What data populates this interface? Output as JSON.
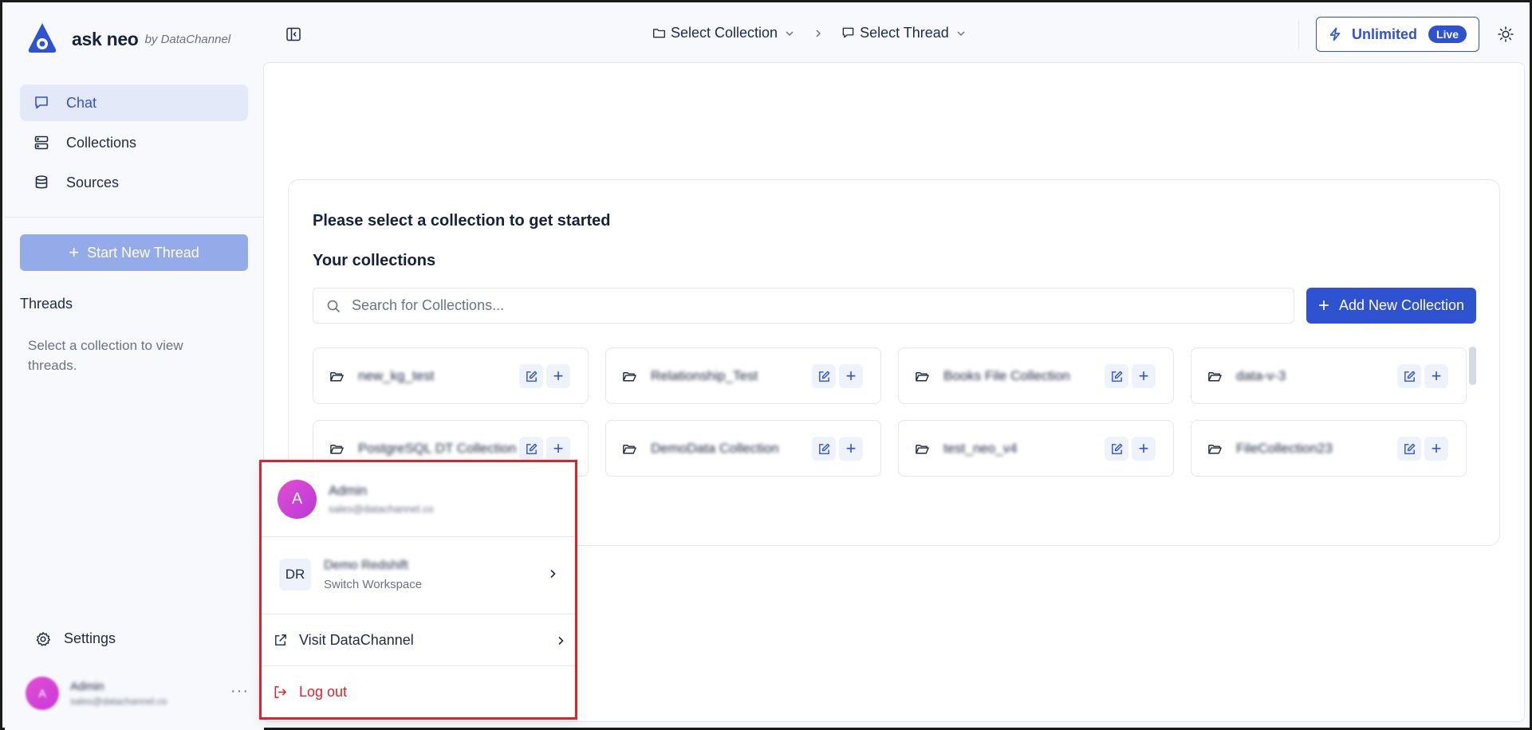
{
  "brand": {
    "name": "ask neo",
    "by": "by DataChannel"
  },
  "nav": [
    {
      "label": "Chat",
      "icon": "chat-icon",
      "active": true
    },
    {
      "label": "Collections",
      "icon": "collections-icon",
      "active": false
    },
    {
      "label": "Sources",
      "icon": "database-icon",
      "active": false
    }
  ],
  "sidebar": {
    "start_thread": "Start New Thread",
    "threads_title": "Threads",
    "threads_empty": "Select a collection to view threads.",
    "settings": "Settings",
    "user": {
      "initial": "A",
      "name": "Admin",
      "email": "sales@datachannel.co"
    },
    "more": "···"
  },
  "topbar": {
    "collection": "Select Collection",
    "thread": "Select Thread",
    "plan": "Unlimited",
    "plan_badge": "Live"
  },
  "main": {
    "title": "Please select a collection to get started",
    "subtitle": "Your collections",
    "search_placeholder": "Search for Collections...",
    "add_button": "Add New Collection",
    "collections": [
      "new_kg_test",
      "Relationship_Test",
      "Books File Collection",
      "data-v-3",
      "PostgreSQL DT Collection",
      "DemoData Collection",
      "test_neo_v4",
      "FileCollection23"
    ]
  },
  "popup": {
    "user_initial": "A",
    "user_name": "Admin",
    "user_email": "sales@datachannel.co",
    "workspace_initials": "DR",
    "workspace_name": "Demo Redshift",
    "workspace_sub": "Switch Workspace",
    "visit": "Visit DataChannel",
    "logout": "Log out"
  },
  "colors": {
    "accent": "#2f52d0",
    "danger": "#d9232d",
    "highlight_border": "#d9232d"
  }
}
